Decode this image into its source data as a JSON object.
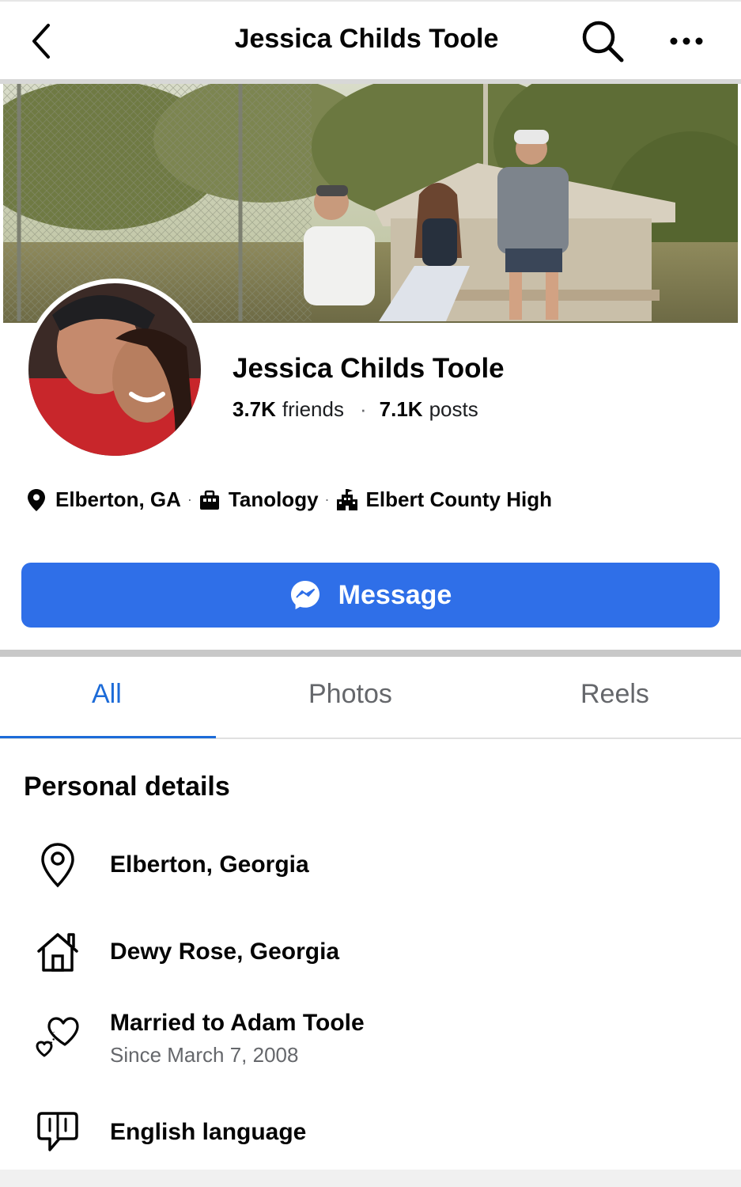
{
  "topbar": {
    "title": "Jessica Childs Toole",
    "back_icon": "chevron-left-icon",
    "search_icon": "search-icon",
    "more_icon": "ellipsis-icon"
  },
  "profile": {
    "name": "Jessica Childs Toole",
    "friends_count": "3.7K",
    "friends_label": "friends",
    "separator": "·",
    "posts_count": "7.1K",
    "posts_label": "posts"
  },
  "intro": {
    "location": "Elberton, GA",
    "work": "Tanology",
    "school": "Elbert County High",
    "separator": "·"
  },
  "message_button": {
    "label": "Message",
    "color": "#2f6fe8"
  },
  "tabs": [
    {
      "label": "All",
      "active": true
    },
    {
      "label": "Photos",
      "active": false
    },
    {
      "label": "Reels",
      "active": false
    }
  ],
  "personal_details": {
    "title": "Personal details",
    "items": [
      {
        "icon": "location-pin-icon",
        "text": "Elberton, Georgia"
      },
      {
        "icon": "home-icon",
        "text": "Dewy Rose, Georgia"
      },
      {
        "icon": "hearts-icon",
        "text": "Married to Adam Toole",
        "sub": "Since March 7, 2008"
      },
      {
        "icon": "speech-bubble-icon",
        "text": "English language"
      }
    ]
  },
  "colors": {
    "accent": "#1c6bd8",
    "text": "#050505",
    "secondary": "#65676b"
  }
}
